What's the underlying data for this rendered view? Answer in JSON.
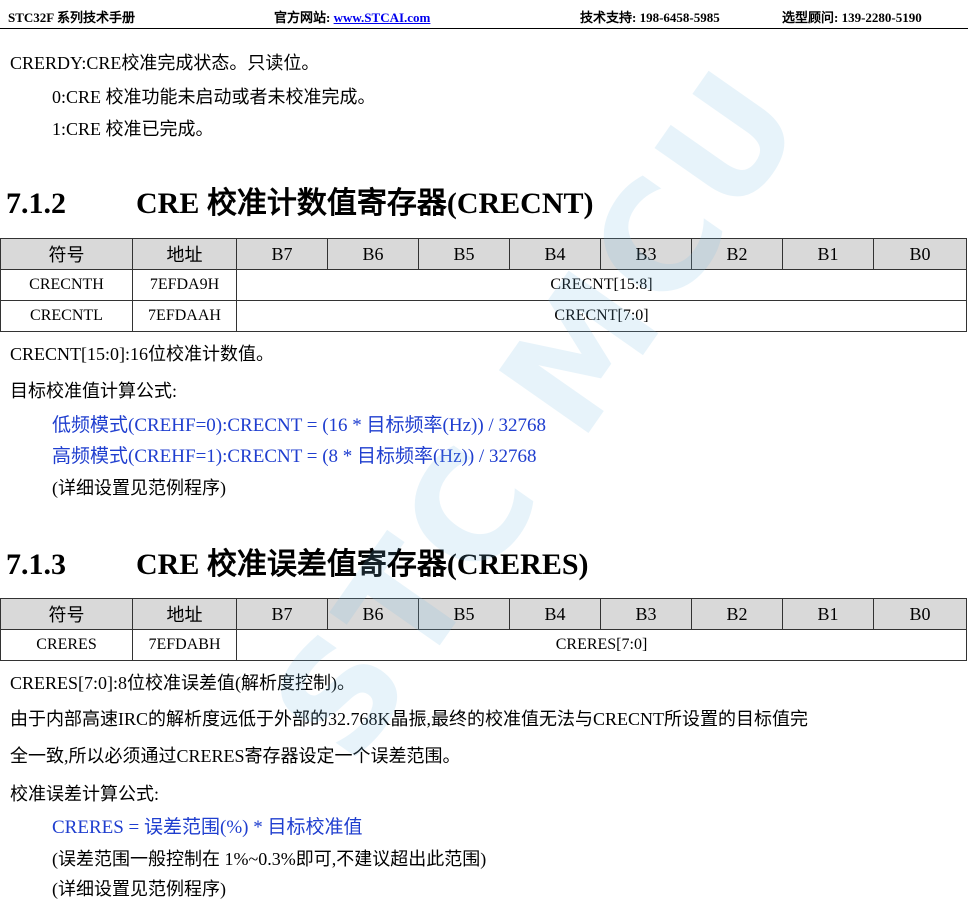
{
  "header": {
    "manual": "STC32F 系列技术手册",
    "site_label": "官方网站:",
    "site_url": "www.STCAI.com",
    "support_label": "技术支持:",
    "support_phone": "198-6458-5985",
    "advisor_label": "选型顾问:",
    "advisor_phone": "139-2280-5190"
  },
  "crerdy": {
    "desc": "CRERDY:CRE校准完成状态。只读位。",
    "v0": "0:CRE 校准功能未启动或者未校准完成。",
    "v1": "1:CRE 校准已完成。"
  },
  "section712": {
    "number": "7.1.2",
    "title": "CRE 校准计数值寄存器(CRECNT)",
    "table": {
      "headers": [
        "符号",
        "地址",
        "B7",
        "B6",
        "B5",
        "B4",
        "B3",
        "B2",
        "B1",
        "B0"
      ],
      "rows": [
        {
          "symbol": "CRECNTH",
          "address": "7EFDA9H",
          "field": "CRECNT[15:8]"
        },
        {
          "symbol": "CRECNTL",
          "address": "7EFDAAH",
          "field": "CRECNT[7:0]"
        }
      ]
    },
    "desc": "CRECNT[15:0]:16位校准计数值。",
    "formula_title": "目标校准值计算公式:",
    "formula_low": "低频模式(CREHF=0):CRECNT = (16 * 目标频率(Hz)) / 32768",
    "formula_high": "高频模式(CREHF=1):CRECNT = (8 * 目标频率(Hz)) / 32768",
    "note": "(详细设置见范例程序)"
  },
  "section713": {
    "number": "7.1.3",
    "title": "CRE 校准误差值寄存器(CRERES)",
    "table": {
      "headers": [
        "符号",
        "地址",
        "B7",
        "B6",
        "B5",
        "B4",
        "B3",
        "B2",
        "B1",
        "B0"
      ],
      "rows": [
        {
          "symbol": "CRERES",
          "address": "7EFDABH",
          "field": "CRERES[7:0]"
        }
      ]
    },
    "desc": "CRERES[7:0]:8位校准误差值(解析度控制)。",
    "para1": "由于内部高速IRC的解析度远低于外部的32.768K晶振,最终的校准值无法与CRECNT所设置的目标值完",
    "para2": "全一致,所以必须通过CRERES寄存器设定一个误差范围。",
    "formula_title": "校准误差计算公式:",
    "formula": "CRERES = 误差范围(%) * 目标校准值",
    "range_note": "(误差范围一般控制在 1%~0.3%即可,不建议超出此范围)",
    "note": "(详细设置见范例程序)"
  },
  "watermark": "STC MCU"
}
